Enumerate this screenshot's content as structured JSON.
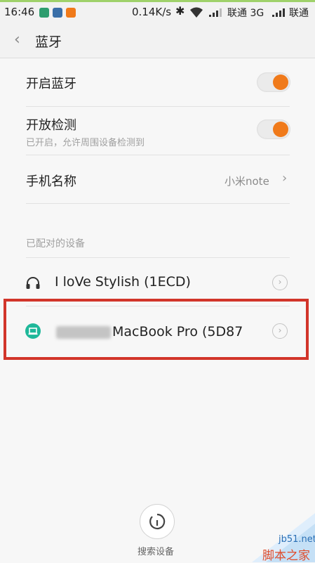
{
  "status_bar": {
    "time": "16:46",
    "network_speed": "0.14K/s",
    "carrier1": "联通 3G",
    "carrier2": "联通"
  },
  "header": {
    "title": "蓝牙"
  },
  "settings": {
    "bluetooth_label": "开启蓝牙",
    "bluetooth_on": true,
    "visibility_label": "开放检测",
    "visibility_sub": "已开启，允许周围设备检测到",
    "visibility_on": true,
    "device_name_label": "手机名称",
    "device_name_value": "小米note"
  },
  "paired": {
    "section_title": "已配对的设备",
    "devices": [
      {
        "name": "I loVe Stylish (1ECD)",
        "icon": "headset-icon"
      },
      {
        "name": "MacBook Pro (5D87",
        "icon": "laptop-icon"
      }
    ]
  },
  "footer": {
    "search_label": "搜索设备"
  },
  "watermark": {
    "url": "jb51.net",
    "brand": "脚本之家"
  },
  "colors": {
    "accent_orange": "#f07a1a",
    "highlight_red": "#d2352a",
    "laptop_icon_bg": "#1fb89a"
  }
}
